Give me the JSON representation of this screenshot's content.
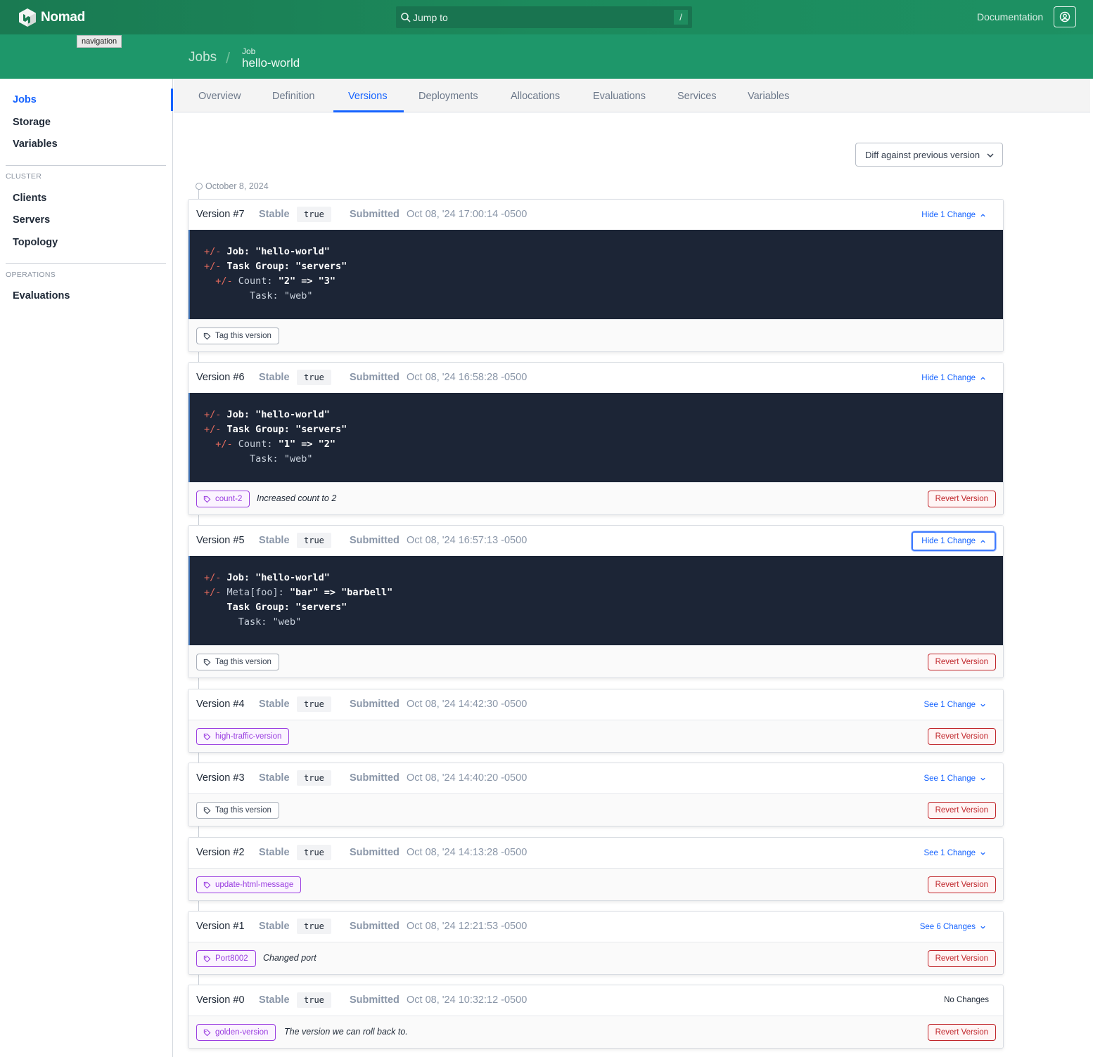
{
  "app": {
    "name": "Nomad",
    "tooltip": "navigation",
    "search_placeholder": "Jump to",
    "search_shortcut": "/",
    "documentation": "Documentation"
  },
  "breadcrumb": {
    "jobs": "Jobs",
    "separator": "/",
    "job_label": "Job",
    "job_name": "hello-world"
  },
  "sidebar": {
    "items": [
      {
        "label": "Jobs",
        "active": true
      },
      {
        "label": "Storage"
      },
      {
        "label": "Variables"
      }
    ],
    "cluster_label": "CLUSTER",
    "cluster_items": [
      {
        "label": "Clients"
      },
      {
        "label": "Servers"
      },
      {
        "label": "Topology"
      }
    ],
    "operations_label": "OPERATIONS",
    "operations_items": [
      {
        "label": "Evaluations"
      }
    ]
  },
  "tabs": [
    {
      "label": "Overview"
    },
    {
      "label": "Definition"
    },
    {
      "label": "Versions",
      "active": true
    },
    {
      "label": "Deployments"
    },
    {
      "label": "Allocations"
    },
    {
      "label": "Evaluations"
    },
    {
      "label": "Services"
    },
    {
      "label": "Variables"
    }
  ],
  "diff_select": {
    "selected": "Diff against previous version"
  },
  "timeline_date": "October 8, 2024",
  "labels": {
    "stable": "Stable",
    "submitted": "Submitted",
    "tag_this_version": "Tag this version",
    "revert_version": "Revert Version"
  },
  "versions": [
    {
      "title": "Version #7",
      "stable": "true",
      "date": "Oct 08, '24 17:00:14 -0500",
      "toggle": "Hide 1 Change",
      "expanded": true,
      "diff": [
        {
          "indent": 0,
          "mark": "+/-",
          "key": "Job: ",
          "keybold": true,
          "value": "\"hello-world\"",
          "valbold": true
        },
        {
          "indent": 0,
          "mark": "+/-",
          "key": "Task Group: ",
          "keybold": true,
          "value": "\"servers\"",
          "valbold": true
        },
        {
          "indent": 1,
          "mark": "+/-",
          "key": "Count: ",
          "keybold": false,
          "value": "\"2\" => \"3\"",
          "valbold": true
        },
        {
          "indent": 2,
          "mark": "",
          "key": "Task: ",
          "keybold": false,
          "value": "\"web\"",
          "valbold": false
        }
      ],
      "tag": null,
      "tag_desc": null,
      "revert": false
    },
    {
      "title": "Version #6",
      "stable": "true",
      "date": "Oct 08, '24 16:58:28 -0500",
      "toggle": "Hide 1 Change",
      "expanded": true,
      "diff": [
        {
          "indent": 0,
          "mark": "+/-",
          "key": "Job: ",
          "keybold": true,
          "value": "\"hello-world\"",
          "valbold": true
        },
        {
          "indent": 0,
          "mark": "+/-",
          "key": "Task Group: ",
          "keybold": true,
          "value": "\"servers\"",
          "valbold": true
        },
        {
          "indent": 1,
          "mark": "+/-",
          "key": "Count: ",
          "keybold": false,
          "value": "\"1\" => \"2\"",
          "valbold": true
        },
        {
          "indent": 2,
          "mark": "",
          "key": "Task: ",
          "keybold": false,
          "value": "\"web\"",
          "valbold": false
        }
      ],
      "tag": "count-2",
      "tag_desc": "Increased count to 2",
      "revert": true
    },
    {
      "title": "Version #5",
      "stable": "true",
      "date": "Oct 08, '24 16:57:13 -0500",
      "toggle": "Hide 1 Change",
      "expanded": true,
      "focused": true,
      "diff": [
        {
          "indent": 0,
          "mark": "+/-",
          "key": "Job: ",
          "keybold": true,
          "value": "\"hello-world\"",
          "valbold": true
        },
        {
          "indent": 0,
          "mark": "+/-",
          "key": "Meta[foo]: ",
          "keybold": false,
          "value": "\"bar\" => \"barbell\"",
          "valbold": true
        },
        {
          "indent": 0,
          "mark": "",
          "key": "Task Group: ",
          "keybold": true,
          "value": "\"servers\"",
          "valbold": true
        },
        {
          "indent": 1,
          "mark": "",
          "key": "Task: ",
          "keybold": false,
          "value": "\"web\"",
          "valbold": false
        }
      ],
      "tag": null,
      "tag_desc": null,
      "revert": true
    },
    {
      "title": "Version #4",
      "stable": "true",
      "date": "Oct 08, '24 14:42:30 -0500",
      "toggle": "See 1 Change",
      "expanded": false,
      "tag": "high-traffic-version",
      "tag_desc": null,
      "revert": true
    },
    {
      "title": "Version #3",
      "stable": "true",
      "date": "Oct 08, '24 14:40:20 -0500",
      "toggle": "See 1 Change",
      "expanded": false,
      "tag": null,
      "tag_desc": null,
      "revert": true
    },
    {
      "title": "Version #2",
      "stable": "true",
      "date": "Oct 08, '24 14:13:28 -0500",
      "toggle": "See 1 Change",
      "expanded": false,
      "tag": "update-html-message",
      "tag_desc": null,
      "revert": true
    },
    {
      "title": "Version #1",
      "stable": "true",
      "date": "Oct 08, '24 12:21:53 -0500",
      "toggle": "See 6 Changes",
      "expanded": false,
      "tag": "Port8002",
      "tag_desc": "Changed port",
      "revert": true
    },
    {
      "title": "Version #0",
      "stable": "true",
      "date": "Oct 08, '24 10:32:12 -0500",
      "toggle": null,
      "no_changes": "No Changes",
      "expanded": false,
      "tag": "golden-version",
      "tag_desc": "The version we can roll back to.",
      "revert": true
    }
  ]
}
